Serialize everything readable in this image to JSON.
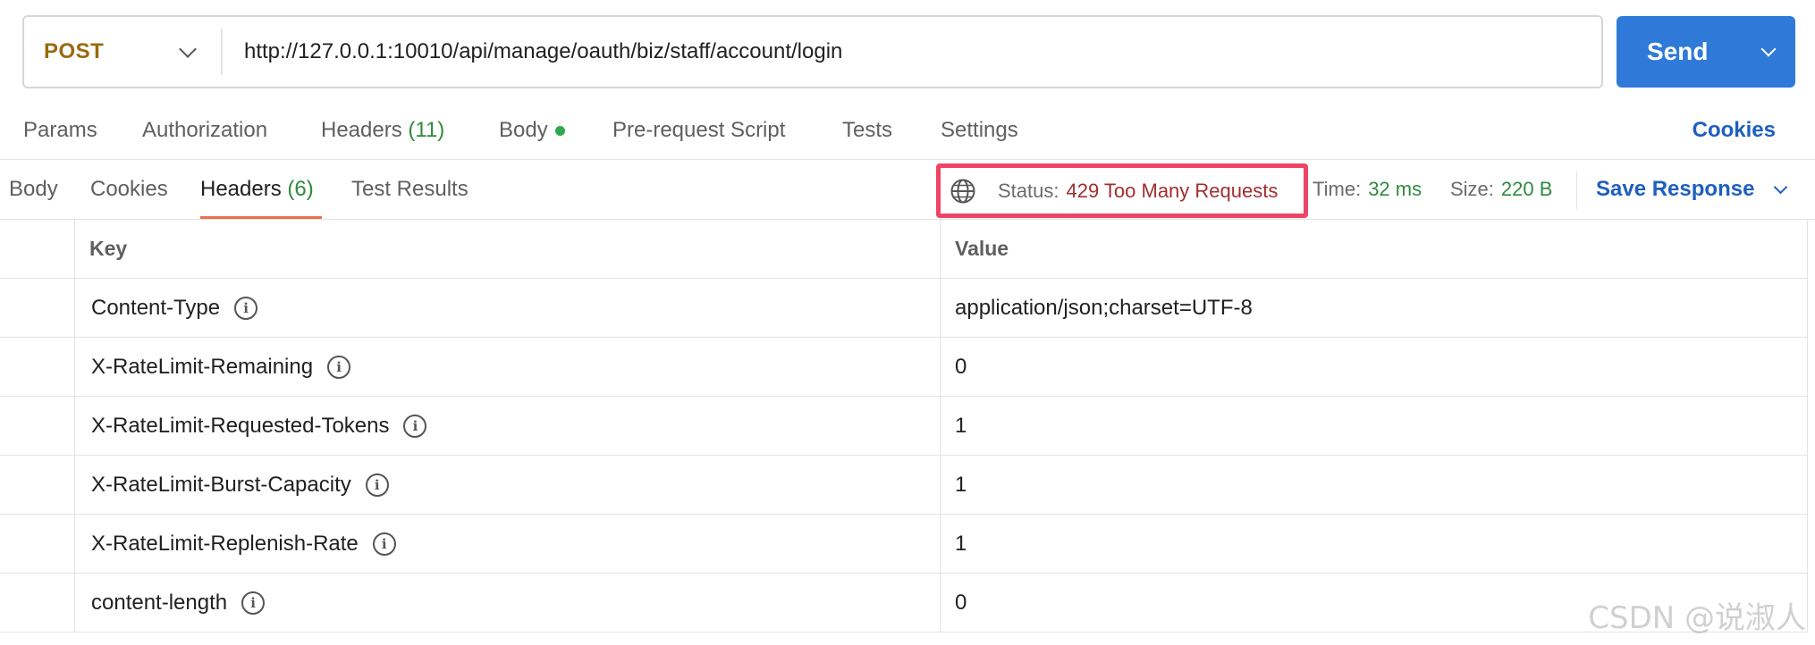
{
  "request": {
    "method": "POST",
    "url": "http://127.0.0.1:10010/api/manage/oauth/biz/staff/account/login",
    "send_label": "Send"
  },
  "request_tabs": [
    {
      "label": "Params"
    },
    {
      "label": "Authorization"
    },
    {
      "label": "Headers",
      "count": "(11)"
    },
    {
      "label": "Body"
    },
    {
      "label": "Pre-request Script"
    },
    {
      "label": "Tests"
    },
    {
      "label": "Settings"
    }
  ],
  "cookies_link": "Cookies",
  "response_tabs": [
    {
      "label": "Body"
    },
    {
      "label": "Cookies"
    },
    {
      "label": "Headers",
      "count": "(6)",
      "active": true
    },
    {
      "label": "Test Results"
    }
  ],
  "response_meta": {
    "status_label": "Status:",
    "status_value": "429 Too Many Requests",
    "time_label": "Time:",
    "time_value": "32 ms",
    "size_label": "Size:",
    "size_value": "220 B",
    "save_label": "Save Response"
  },
  "headers_table": {
    "columns": [
      "Key",
      "Value"
    ],
    "rows": [
      {
        "key": "Content-Type",
        "value": "application/json;charset=UTF-8"
      },
      {
        "key": "X-RateLimit-Remaining",
        "value": "0"
      },
      {
        "key": "X-RateLimit-Requested-Tokens",
        "value": "1"
      },
      {
        "key": "X-RateLimit-Burst-Capacity",
        "value": "1"
      },
      {
        "key": "X-RateLimit-Replenish-Rate",
        "value": "1"
      },
      {
        "key": "content-length",
        "value": "0"
      }
    ]
  },
  "watermark": "CSDN @说淑人",
  "colors": {
    "accent": "#2f7ad8",
    "status_error": "#a22e2e",
    "highlight_box": "#ee4466",
    "success": "#2f8a3e"
  }
}
